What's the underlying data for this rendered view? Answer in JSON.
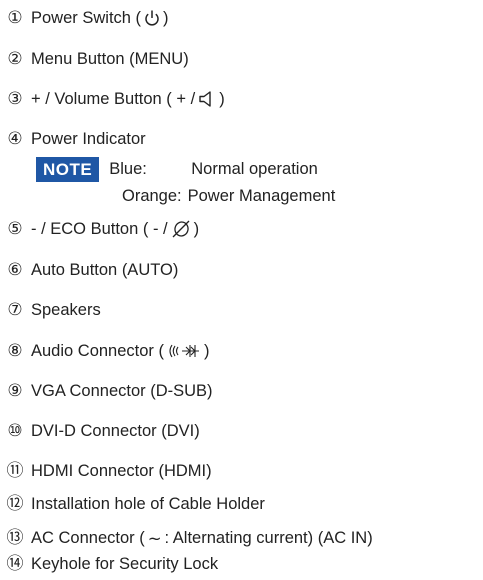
{
  "items": [
    {
      "num": "①",
      "pre": "Power Switch (",
      "icon": "power-icon",
      "post": ")"
    },
    {
      "num": "②",
      "text": "Menu Button (MENU)"
    },
    {
      "num": "③",
      "pre": "+ / Volume Button ( + /",
      "icon": "speaker-icon",
      "post": ")"
    },
    {
      "num": "④",
      "text": "Power Indicator"
    },
    {
      "num": "⑤",
      "pre": "- / ECO Button ( - /",
      "icon": "eco-icon",
      "post": ")"
    },
    {
      "num": "⑥",
      "text": "Auto Button (AUTO)"
    },
    {
      "num": "⑦",
      "text": "Speakers"
    },
    {
      "num": "⑧",
      "pre": "Audio Connector (",
      "icon": "audio-connector-icon",
      "post": ")"
    },
    {
      "num": "⑨",
      "text": "VGA Connector (D-SUB)"
    },
    {
      "num": "⑩",
      "text": "DVI-D Connector (DVI)"
    },
    {
      "num": "⑪",
      "text": "HDMI Connector (HDMI)"
    },
    {
      "num": "⑫",
      "text": "Installation hole of Cable Holder"
    },
    {
      "num": "⑬",
      "pre": "AC Connector (",
      "symbol": "∼",
      "post": ": Alternating current) (AC IN)"
    },
    {
      "num": "⑭",
      "text": "Keyhole for Security Lock"
    }
  ],
  "note": {
    "badge": "NOTE",
    "rows": [
      {
        "key": "Blue:",
        "value": "Normal operation"
      },
      {
        "key": "Orange:",
        "value": "Power Management"
      }
    ]
  },
  "colors": {
    "note_badge": "#1f57a5",
    "text": "#222222"
  }
}
